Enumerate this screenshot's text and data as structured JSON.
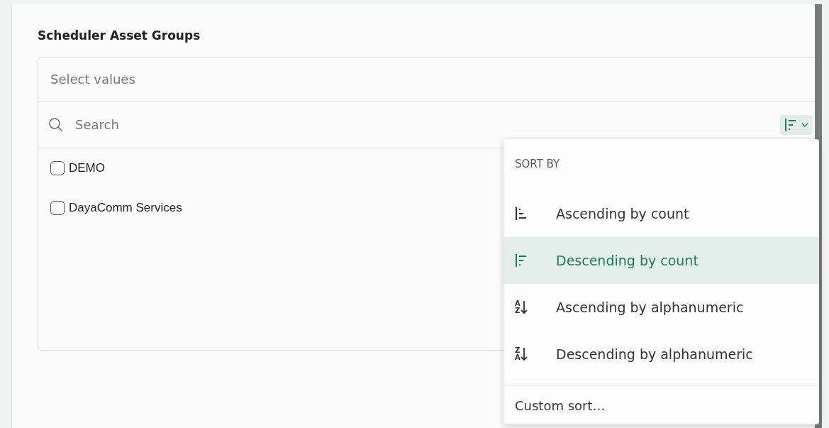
{
  "field": {
    "label": "Scheduler Asset Groups",
    "placeholder": "Select values"
  },
  "search": {
    "placeholder": "Search"
  },
  "values": [
    {
      "label": "DEMO",
      "checked": false
    },
    {
      "label": "DayaComm Services",
      "checked": false
    }
  ],
  "sort_menu": {
    "heading": "SORT BY",
    "items": [
      {
        "kind": "asc-count",
        "label": "Ascending by count",
        "selected": false
      },
      {
        "kind": "desc-count",
        "label": "Descending by count",
        "selected": true
      },
      {
        "kind": "asc-alpha",
        "label": "Ascending by alphanumeric",
        "selected": false,
        "icon_text": [
          "A",
          "Z"
        ]
      },
      {
        "kind": "desc-alpha",
        "label": "Descending by alphanumeric",
        "selected": false,
        "icon_text": [
          "Z",
          "A"
        ]
      }
    ],
    "footer": "Custom sort…"
  }
}
